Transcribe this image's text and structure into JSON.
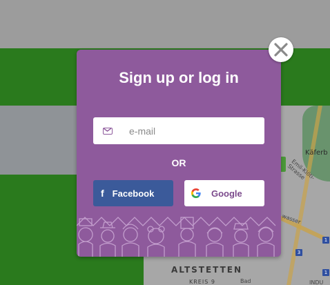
{
  "modal": {
    "title": "Sign up or log in",
    "email": {
      "placeholder": "e-mail",
      "value": ""
    },
    "divider": "OR",
    "facebook_label": "Facebook",
    "google_label": "Google"
  },
  "map": {
    "labels": {
      "district": "ALTSTETTEN",
      "kreis": "KREIS 9",
      "kafer": "Käferb",
      "street": "Emil-Klöti-Strasse",
      "wasser": "wasser",
      "bad": "Bad",
      "indu": "INDU"
    },
    "badges": [
      "1",
      "3",
      "1"
    ]
  },
  "colors": {
    "modal_bg": "#8e5a9c",
    "facebook_bg": "#3b5a9a",
    "google_bg": "#ffffff",
    "green_stripe": "#2a7a1d"
  },
  "icons": {
    "close": "close-icon",
    "email": "mail-icon",
    "facebook": "facebook-icon",
    "google": "google-icon"
  }
}
